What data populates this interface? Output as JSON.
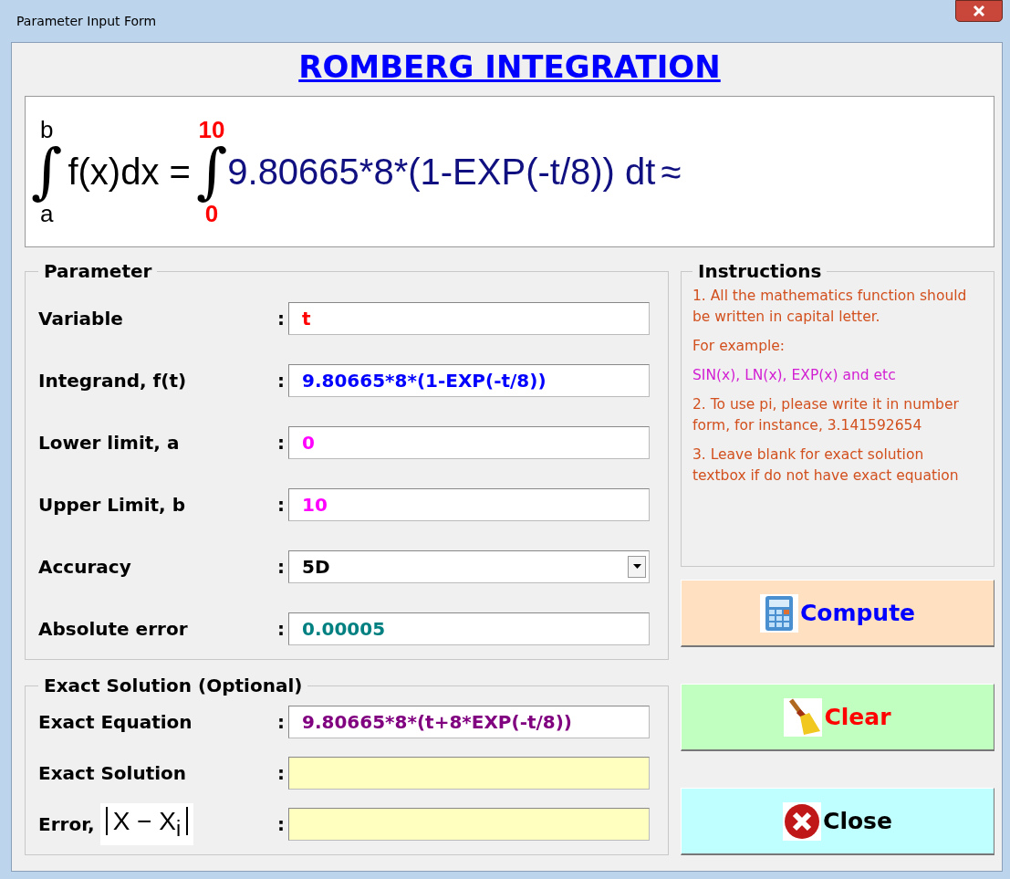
{
  "window": {
    "title": "Parameter Input Form"
  },
  "heading": "ROMBERG INTEGRATION",
  "formula": {
    "symbol": "∫",
    "upper": "b",
    "lower": "a",
    "lhs": "f(x)dx =",
    "upper_limit": "10",
    "lower_limit": "0",
    "integrand": "9.80665*8*(1-EXP(-t/8)) dt",
    "approx": "≈"
  },
  "parameter": {
    "legend": "Parameter",
    "fields": [
      {
        "label": "Variable",
        "separator": ":",
        "value": "t",
        "color": "#ff0000",
        "kind": "text"
      },
      {
        "label": "Integrand, f(t)",
        "separator": ":",
        "value": "9.80665*8*(1-EXP(-t/8))",
        "color": "#0000ff",
        "kind": "text"
      },
      {
        "label": "Lower limit, a",
        "separator": ":",
        "value": "0",
        "color": "#ff00ff",
        "kind": "text"
      },
      {
        "label": "Upper Limit, b",
        "separator": ":",
        "value": "10",
        "color": "#ff00ff",
        "kind": "text"
      },
      {
        "label": "Accuracy",
        "separator": ":",
        "value": "5D",
        "color": "#000000",
        "kind": "dropdown"
      },
      {
        "label": "Absolute error",
        "separator": ":",
        "value": "0.00005",
        "color": "#008080",
        "kind": "text"
      }
    ]
  },
  "exact": {
    "legend": "Exact Solution (Optional)",
    "fields": [
      {
        "label": "Exact Equation",
        "separator": ":",
        "value": "9.80665*8*(t+8*EXP(-t/8))",
        "color": "#800080",
        "readonly": false
      },
      {
        "label": "Exact Solution",
        "separator": ":",
        "readonly": true
      },
      {
        "label": "Error,",
        "formula": "X − X$_{i}$",
        "separator": ":",
        "readonly": true
      }
    ]
  },
  "instructions": {
    "legend": "Instructions",
    "paragraphs": [
      {
        "text": "1. All the mathematics function should be written in capital letter.",
        "color": "#d2501e"
      },
      {
        "text": "For example:",
        "color": "#d2501e"
      },
      {
        "text": "SIN(x), LN(x), EXP(x) and etc",
        "color": "#d21ed2"
      },
      {
        "text": "2. To use pi, please write it in number form, for instance, 3.141592654",
        "color": "#d2501e"
      },
      {
        "text": "3. Leave blank for exact solution textbox if do not have exact equation",
        "color": "#d2501e"
      }
    ]
  },
  "buttons": [
    {
      "label": "Compute",
      "kind": "compute",
      "color": "#ffe0c0"
    },
    {
      "label": "Clear",
      "kind": "clear",
      "color": "#c0ffc0"
    },
    {
      "label": "Close",
      "kind": "close",
      "color": "#c0ffff"
    }
  ]
}
